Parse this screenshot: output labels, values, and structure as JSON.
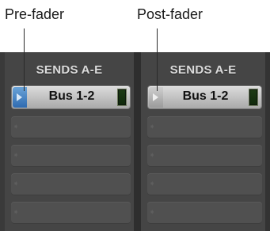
{
  "callouts": {
    "pre": "Pre-fader",
    "post": "Post-fader"
  },
  "strips": [
    {
      "header": "SENDS A-E",
      "send": {
        "name": "Bus 1-2",
        "mode": "pre-fader"
      },
      "empty_slots": 4
    },
    {
      "header": "SENDS A-E",
      "send": {
        "name": "Bus 1-2",
        "mode": "post-fader"
      },
      "empty_slots": 4
    }
  ],
  "colors": {
    "pre_fader_indicator": "#3b7bc4",
    "post_fader_indicator": "#b5b5b5",
    "panel_background": "#454545"
  }
}
